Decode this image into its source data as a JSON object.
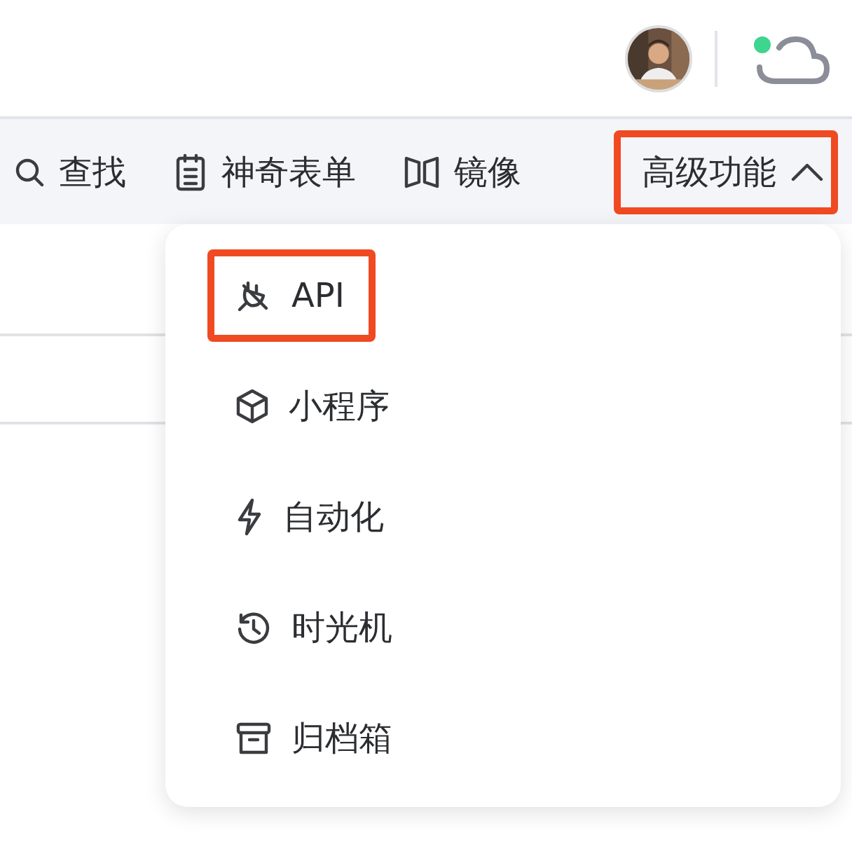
{
  "header": {
    "cloud_online": true
  },
  "toolbar": [
    {
      "kind": "search",
      "label": "查找",
      "highlighted": false
    },
    {
      "kind": "form",
      "label": "神奇表单",
      "highlighted": false
    },
    {
      "kind": "mirror",
      "label": "镜像",
      "highlighted": false
    },
    {
      "kind": "dropdown",
      "label": "高级功能",
      "highlighted": true,
      "expanded": true
    }
  ],
  "menu": [
    {
      "kind": "api",
      "label": "API",
      "highlighted": true
    },
    {
      "kind": "miniapp",
      "label": "小程序",
      "highlighted": false
    },
    {
      "kind": "automation",
      "label": "自动化",
      "highlighted": false
    },
    {
      "kind": "history",
      "label": "时光机",
      "highlighted": false
    },
    {
      "kind": "archive",
      "label": "归档箱",
      "highlighted": false
    }
  ]
}
